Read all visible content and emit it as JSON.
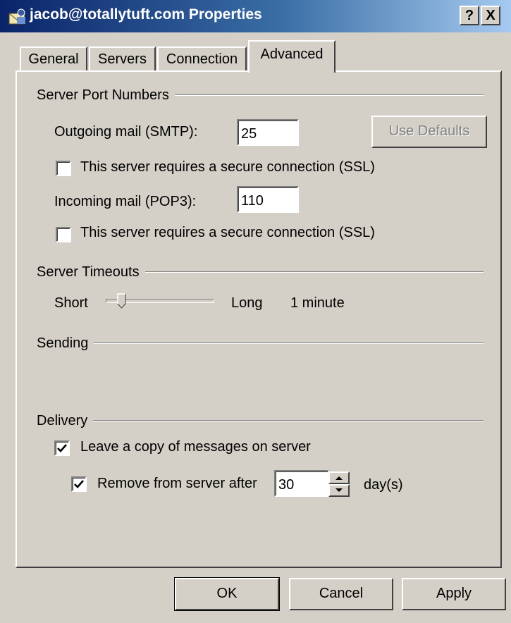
{
  "window": {
    "title": "jacob@totallytuft.com Properties",
    "help_label": "?",
    "close_label": "X"
  },
  "tabs": [
    {
      "label": "General",
      "active": false
    },
    {
      "label": "Servers",
      "active": false
    },
    {
      "label": "Connection",
      "active": false
    },
    {
      "label": "Advanced",
      "active": true
    }
  ],
  "server_ports": {
    "group_label": "Server Port Numbers",
    "outgoing_label": "Outgoing mail (SMTP):",
    "outgoing_value": "25",
    "use_defaults_label": "Use Defaults",
    "outgoing_ssl_label": "This server requires a secure connection (SSL)",
    "outgoing_ssl_checked": false,
    "incoming_label": "Incoming mail (POP3):",
    "incoming_value": "110",
    "incoming_ssl_label": "This server requires a secure connection (SSL)",
    "incoming_ssl_checked": false
  },
  "timeouts": {
    "group_label": "Server Timeouts",
    "short_label": "Short",
    "long_label": "Long",
    "value_label": "1 minute",
    "slider_fraction": 0.15
  },
  "sending": {
    "group_label": "Sending"
  },
  "delivery": {
    "group_label": "Delivery",
    "leave_copy_label": "Leave a copy of messages on server",
    "leave_copy_checked": true,
    "remove_after_label": "Remove from server after",
    "remove_after_checked": true,
    "remove_after_value": "30",
    "days_label": "day(s)"
  },
  "footer": {
    "ok_label": "OK",
    "cancel_label": "Cancel",
    "apply_label": "Apply"
  },
  "icons": {
    "window": "mail-account-icon",
    "check": "checkmark-icon"
  }
}
